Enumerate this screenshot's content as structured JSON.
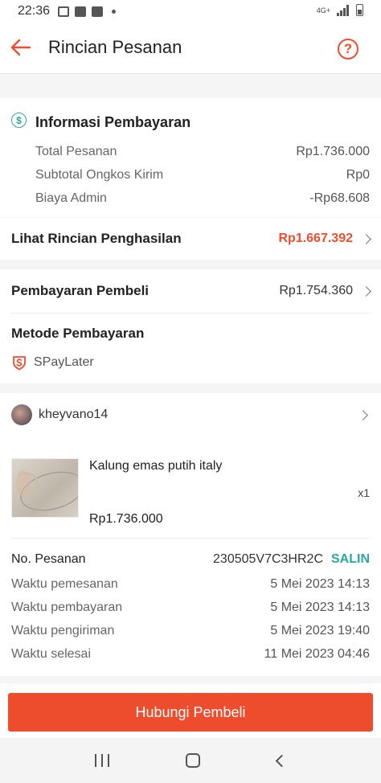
{
  "status_bar": {
    "time": "22:36",
    "network": "4G+"
  },
  "header": {
    "title": "Rincian Pesanan",
    "help_label": "?"
  },
  "payment_info": {
    "title": "Informasi Pembayaran",
    "rows": [
      {
        "label": "Total Pesanan",
        "value": "Rp1.736.000"
      },
      {
        "label": "Subtotal Ongkos Kirim",
        "value": "Rp0"
      },
      {
        "label": "Biaya Admin",
        "value": "-Rp68.608"
      }
    ]
  },
  "income": {
    "label": "Lihat Rincian Penghasilan",
    "value": "Rp1.667.392",
    "value_color": "#ee4d2d"
  },
  "buyer_payment": {
    "label": "Pembayaran Pembeli",
    "value": "Rp1.754.360"
  },
  "payment_method": {
    "title": "Metode Pembayaran",
    "method": "SPayLater"
  },
  "buyer": {
    "username": "kheyvano14"
  },
  "product": {
    "name": "Kalung emas putih italy",
    "quantity": "x1",
    "price": "Rp1.736.000"
  },
  "order": {
    "number_label": "No. Pesanan",
    "number": "230505V7C3HR2C",
    "copy_label": "SALIN",
    "times": [
      {
        "label": "Waktu pemesanan",
        "value": "5 Mei 2023 14:13"
      },
      {
        "label": "Waktu pembayaran",
        "value": "5 Mei 2023 14:13"
      },
      {
        "label": "Waktu pengiriman",
        "value": "5 Mei 2023 19:40"
      },
      {
        "label": "Waktu selesai",
        "value": "11 Mei 2023 04:46"
      }
    ]
  },
  "cta": {
    "label": "Hubungi Pembeli"
  },
  "colors": {
    "accent": "#ee4d2d",
    "teal": "#26aa99"
  }
}
